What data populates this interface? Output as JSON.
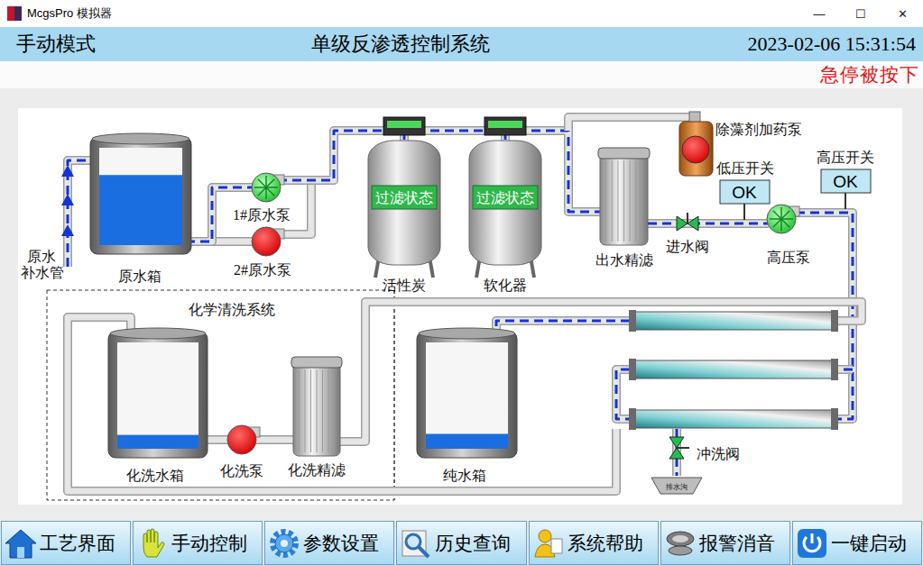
{
  "window": {
    "title": "McgsPro 模拟器",
    "controls": [
      {
        "name": "minimize",
        "glyph": "—"
      },
      {
        "name": "maximize",
        "glyph": "☐"
      },
      {
        "name": "close",
        "glyph": "✕"
      }
    ]
  },
  "header": {
    "mode": "手动模式",
    "title": "单级反渗透控制系统",
    "datetime": "2023-02-06 15:31:54"
  },
  "alarm": {
    "text": "急停被按下",
    "active": true
  },
  "diagram": {
    "makeup_label": [
      "原水",
      "补水管"
    ],
    "tanks": [
      {
        "name": "原水箱",
        "level": 0.72
      },
      {
        "name": "化洗水箱",
        "level": 0.13
      },
      {
        "name": "纯水箱",
        "level": 0.14
      }
    ],
    "pumps": [
      {
        "name": "1#原水泵",
        "on": true
      },
      {
        "name": "2#原水泵",
        "on": false
      },
      {
        "name": "高压泵",
        "on": true
      },
      {
        "name": "化洗泵",
        "on": false
      },
      {
        "name": "除藻剂加药泵",
        "on": false
      }
    ],
    "vessels": [
      {
        "name": "活性炭",
        "status": "过滤状态"
      },
      {
        "name": "软化器",
        "status": "过滤状态"
      }
    ],
    "filters": [
      {
        "name": "出水精滤"
      },
      {
        "name": "化洗精滤"
      }
    ],
    "valves": [
      {
        "name": "进水阀",
        "open": true
      },
      {
        "name": "冲洗阀",
        "open": true
      }
    ],
    "switches": [
      {
        "name": "低压开关",
        "value": "OK"
      },
      {
        "name": "高压开关",
        "value": "OK"
      }
    ],
    "cleaning_group": "化学清洗系统",
    "drain": "排水沟",
    "flows": {
      "makeup": true,
      "pump1": true,
      "pump2": false,
      "dosing": false,
      "main": true,
      "permeate": true,
      "concentrate": true,
      "flush": true,
      "cleaning": false
    }
  },
  "nav": [
    {
      "label": "工艺界面"
    },
    {
      "label": "手动控制"
    },
    {
      "label": "参数设置"
    },
    {
      "label": "历史查询"
    },
    {
      "label": "系统帮助"
    },
    {
      "label": "报警消音"
    },
    {
      "label": "一键启动"
    }
  ]
}
